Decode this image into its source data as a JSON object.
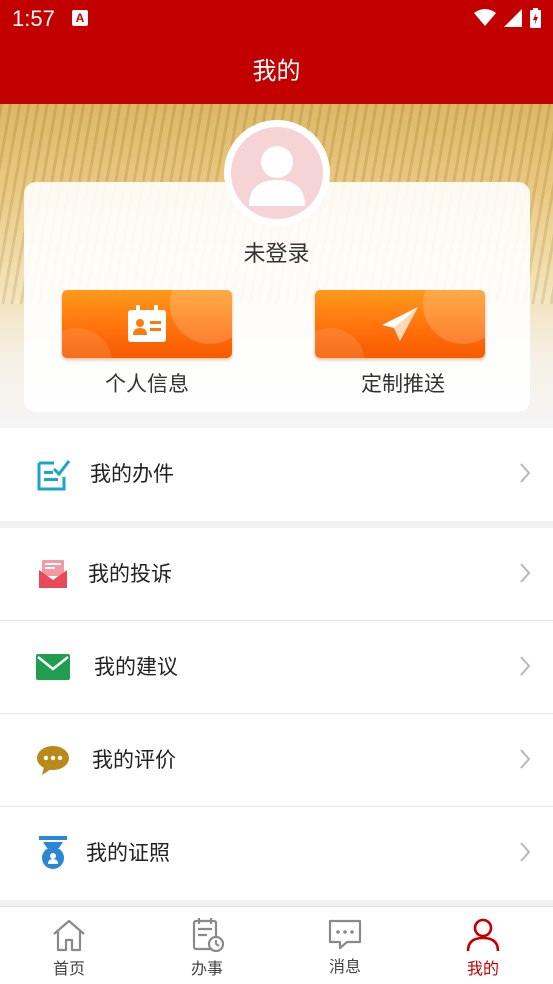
{
  "status": {
    "time": "1:57",
    "notif_letter": "A"
  },
  "header": {
    "title": "我的"
  },
  "profile": {
    "name": "未登录"
  },
  "quick_actions": [
    {
      "label": "个人信息",
      "icon": "id-card-icon"
    },
    {
      "label": "定制推送",
      "icon": "paper-plane-icon"
    }
  ],
  "menu": {
    "items": [
      {
        "label": "我的办件",
        "icon": "edit-list-icon",
        "color": "#1aa6c8"
      },
      {
        "label": "我的投诉",
        "icon": "complaint-mail-icon",
        "color": "#e84a5a"
      },
      {
        "label": "我的建议",
        "icon": "envelope-icon",
        "color": "#1e9e4e"
      },
      {
        "label": "我的评价",
        "icon": "chat-bubble-icon",
        "color": "#b98a1a"
      },
      {
        "label": "我的证照",
        "icon": "certificate-icon",
        "color": "#2a86d6"
      }
    ]
  },
  "tabs": [
    {
      "label": "首页",
      "icon": "home-icon"
    },
    {
      "label": "办事",
      "icon": "calendar-clock-icon"
    },
    {
      "label": "消息",
      "icon": "message-icon"
    },
    {
      "label": "我的",
      "icon": "user-icon",
      "active": true
    }
  ],
  "colors": {
    "brand": "#c20000",
    "accent_orange": "#ff7a0a"
  }
}
